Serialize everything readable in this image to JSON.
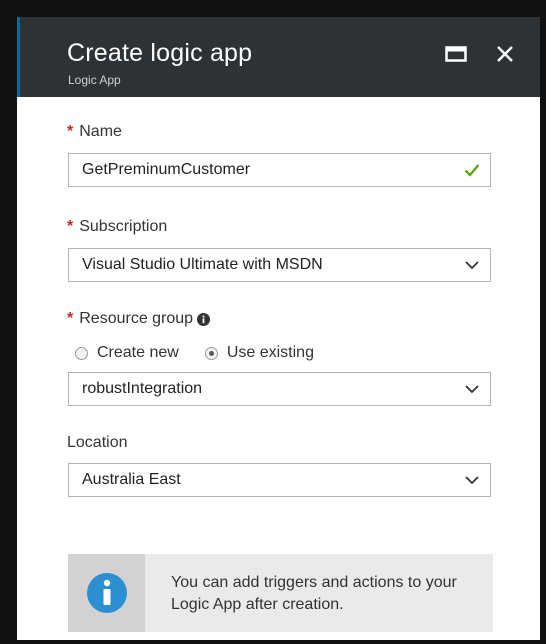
{
  "header": {
    "title": "Create logic app",
    "subtitle": "Logic App"
  },
  "form": {
    "required_marker": "*",
    "name": {
      "label": "Name",
      "value": "GetPreminumCustomer",
      "valid_icon": "checkmark-icon"
    },
    "subscription": {
      "label": "Subscription",
      "value": "Visual Studio Ultimate with MSDN"
    },
    "resource_group": {
      "label": "Resource group",
      "info_icon": "info-icon",
      "options": [
        {
          "label": "Create new",
          "selected": false
        },
        {
          "label": "Use existing",
          "selected": true
        }
      ],
      "value": "robustIntegration"
    },
    "location": {
      "label": "Location",
      "value": "Australia East"
    }
  },
  "info": {
    "text": "You can add triggers and actions to your Logic App after creation."
  },
  "colors": {
    "header_bg": "#2f3235",
    "required": "#c42b1c",
    "valid": "#57a300",
    "info_icon": "#2b8fd1"
  }
}
